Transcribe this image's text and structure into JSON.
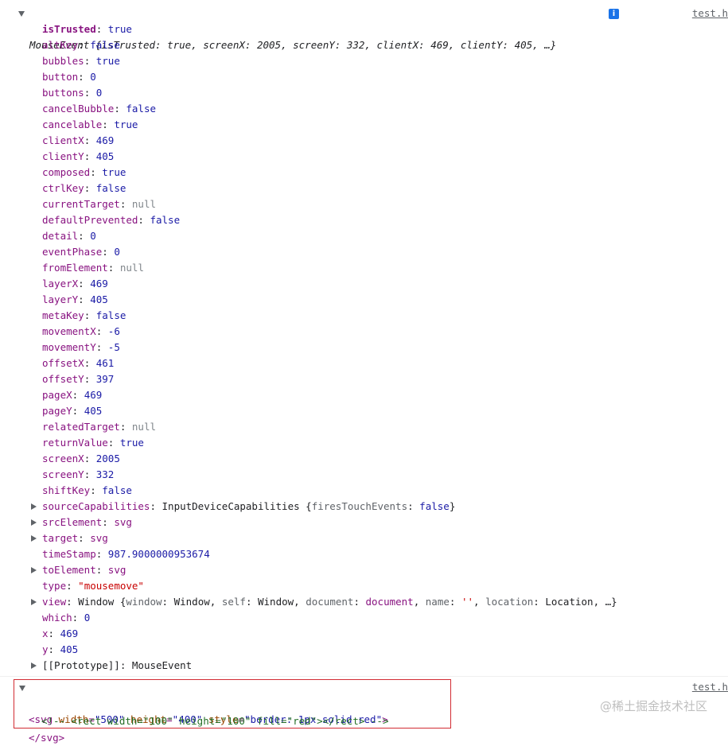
{
  "log1": {
    "source_link": "test.h",
    "header_text": "MouseEvent {isTrusted: true, screenX: 2005, screenY: 332, clientX: 469, clientY: 405, …}",
    "info_icon": "i",
    "props": [
      {
        "key": "isTrusted",
        "value": "true",
        "type": "bool",
        "own": true
      },
      {
        "key": "altKey",
        "value": "false",
        "type": "bool"
      },
      {
        "key": "bubbles",
        "value": "true",
        "type": "bool"
      },
      {
        "key": "button",
        "value": "0",
        "type": "num"
      },
      {
        "key": "buttons",
        "value": "0",
        "type": "num"
      },
      {
        "key": "cancelBubble",
        "value": "false",
        "type": "bool"
      },
      {
        "key": "cancelable",
        "value": "true",
        "type": "bool"
      },
      {
        "key": "clientX",
        "value": "469",
        "type": "num"
      },
      {
        "key": "clientY",
        "value": "405",
        "type": "num"
      },
      {
        "key": "composed",
        "value": "true",
        "type": "bool"
      },
      {
        "key": "ctrlKey",
        "value": "false",
        "type": "bool"
      },
      {
        "key": "currentTarget",
        "value": "null",
        "type": "null"
      },
      {
        "key": "defaultPrevented",
        "value": "false",
        "type": "bool"
      },
      {
        "key": "detail",
        "value": "0",
        "type": "num"
      },
      {
        "key": "eventPhase",
        "value": "0",
        "type": "num"
      },
      {
        "key": "fromElement",
        "value": "null",
        "type": "null"
      },
      {
        "key": "layerX",
        "value": "469",
        "type": "num"
      },
      {
        "key": "layerY",
        "value": "405",
        "type": "num"
      },
      {
        "key": "metaKey",
        "value": "false",
        "type": "bool"
      },
      {
        "key": "movementX",
        "value": "-6",
        "type": "num"
      },
      {
        "key": "movementY",
        "value": "-5",
        "type": "num"
      },
      {
        "key": "offsetX",
        "value": "461",
        "type": "num"
      },
      {
        "key": "offsetY",
        "value": "397",
        "type": "num"
      },
      {
        "key": "pageX",
        "value": "469",
        "type": "num"
      },
      {
        "key": "pageY",
        "value": "405",
        "type": "num"
      },
      {
        "key": "relatedTarget",
        "value": "null",
        "type": "null"
      },
      {
        "key": "returnValue",
        "value": "true",
        "type": "bool"
      },
      {
        "key": "screenX",
        "value": "2005",
        "type": "num"
      },
      {
        "key": "screenY",
        "value": "332",
        "type": "num"
      },
      {
        "key": "shiftKey",
        "value": "false",
        "type": "bool"
      },
      {
        "key": "sourceCapabilities",
        "value": "InputDeviceCapabilities {firesTouchEvents: false}",
        "type": "obj",
        "expandable": true
      },
      {
        "key": "srcElement",
        "value": "svg",
        "type": "obj",
        "expandable": true
      },
      {
        "key": "target",
        "value": "svg",
        "type": "obj",
        "expandable": true
      },
      {
        "key": "timeStamp",
        "value": "987.9000000953674",
        "type": "num"
      },
      {
        "key": "toElement",
        "value": "svg",
        "type": "obj",
        "expandable": true
      },
      {
        "key": "type",
        "value": "\"mousemove\"",
        "type": "str"
      },
      {
        "key": "view",
        "value": "Window {window: Window, self: Window, document: document, name: '', location: Location, …}",
        "type": "obj",
        "expandable": true
      },
      {
        "key": "which",
        "value": "0",
        "type": "num"
      },
      {
        "key": "x",
        "value": "469",
        "type": "num"
      },
      {
        "key": "y",
        "value": "405",
        "type": "num"
      },
      {
        "key": "[[Prototype]]",
        "value": "MouseEvent",
        "type": "obj",
        "expandable": true,
        "proto": true
      }
    ]
  },
  "log2": {
    "source_link": "test.h",
    "open_tag": {
      "name": "svg",
      "attrs": [
        {
          "name": "width",
          "value": "\"500\""
        },
        {
          "name": "height",
          "value": "\"400\""
        },
        {
          "name": "style",
          "value": "\"border: 1px solid red\""
        }
      ]
    },
    "comment": "<!-- <rect width=\"100\" height=\"100\" fill=\"red\"></rect> -->",
    "close_tag": "</svg>"
  },
  "watermark": "@稀土掘金技术社区"
}
